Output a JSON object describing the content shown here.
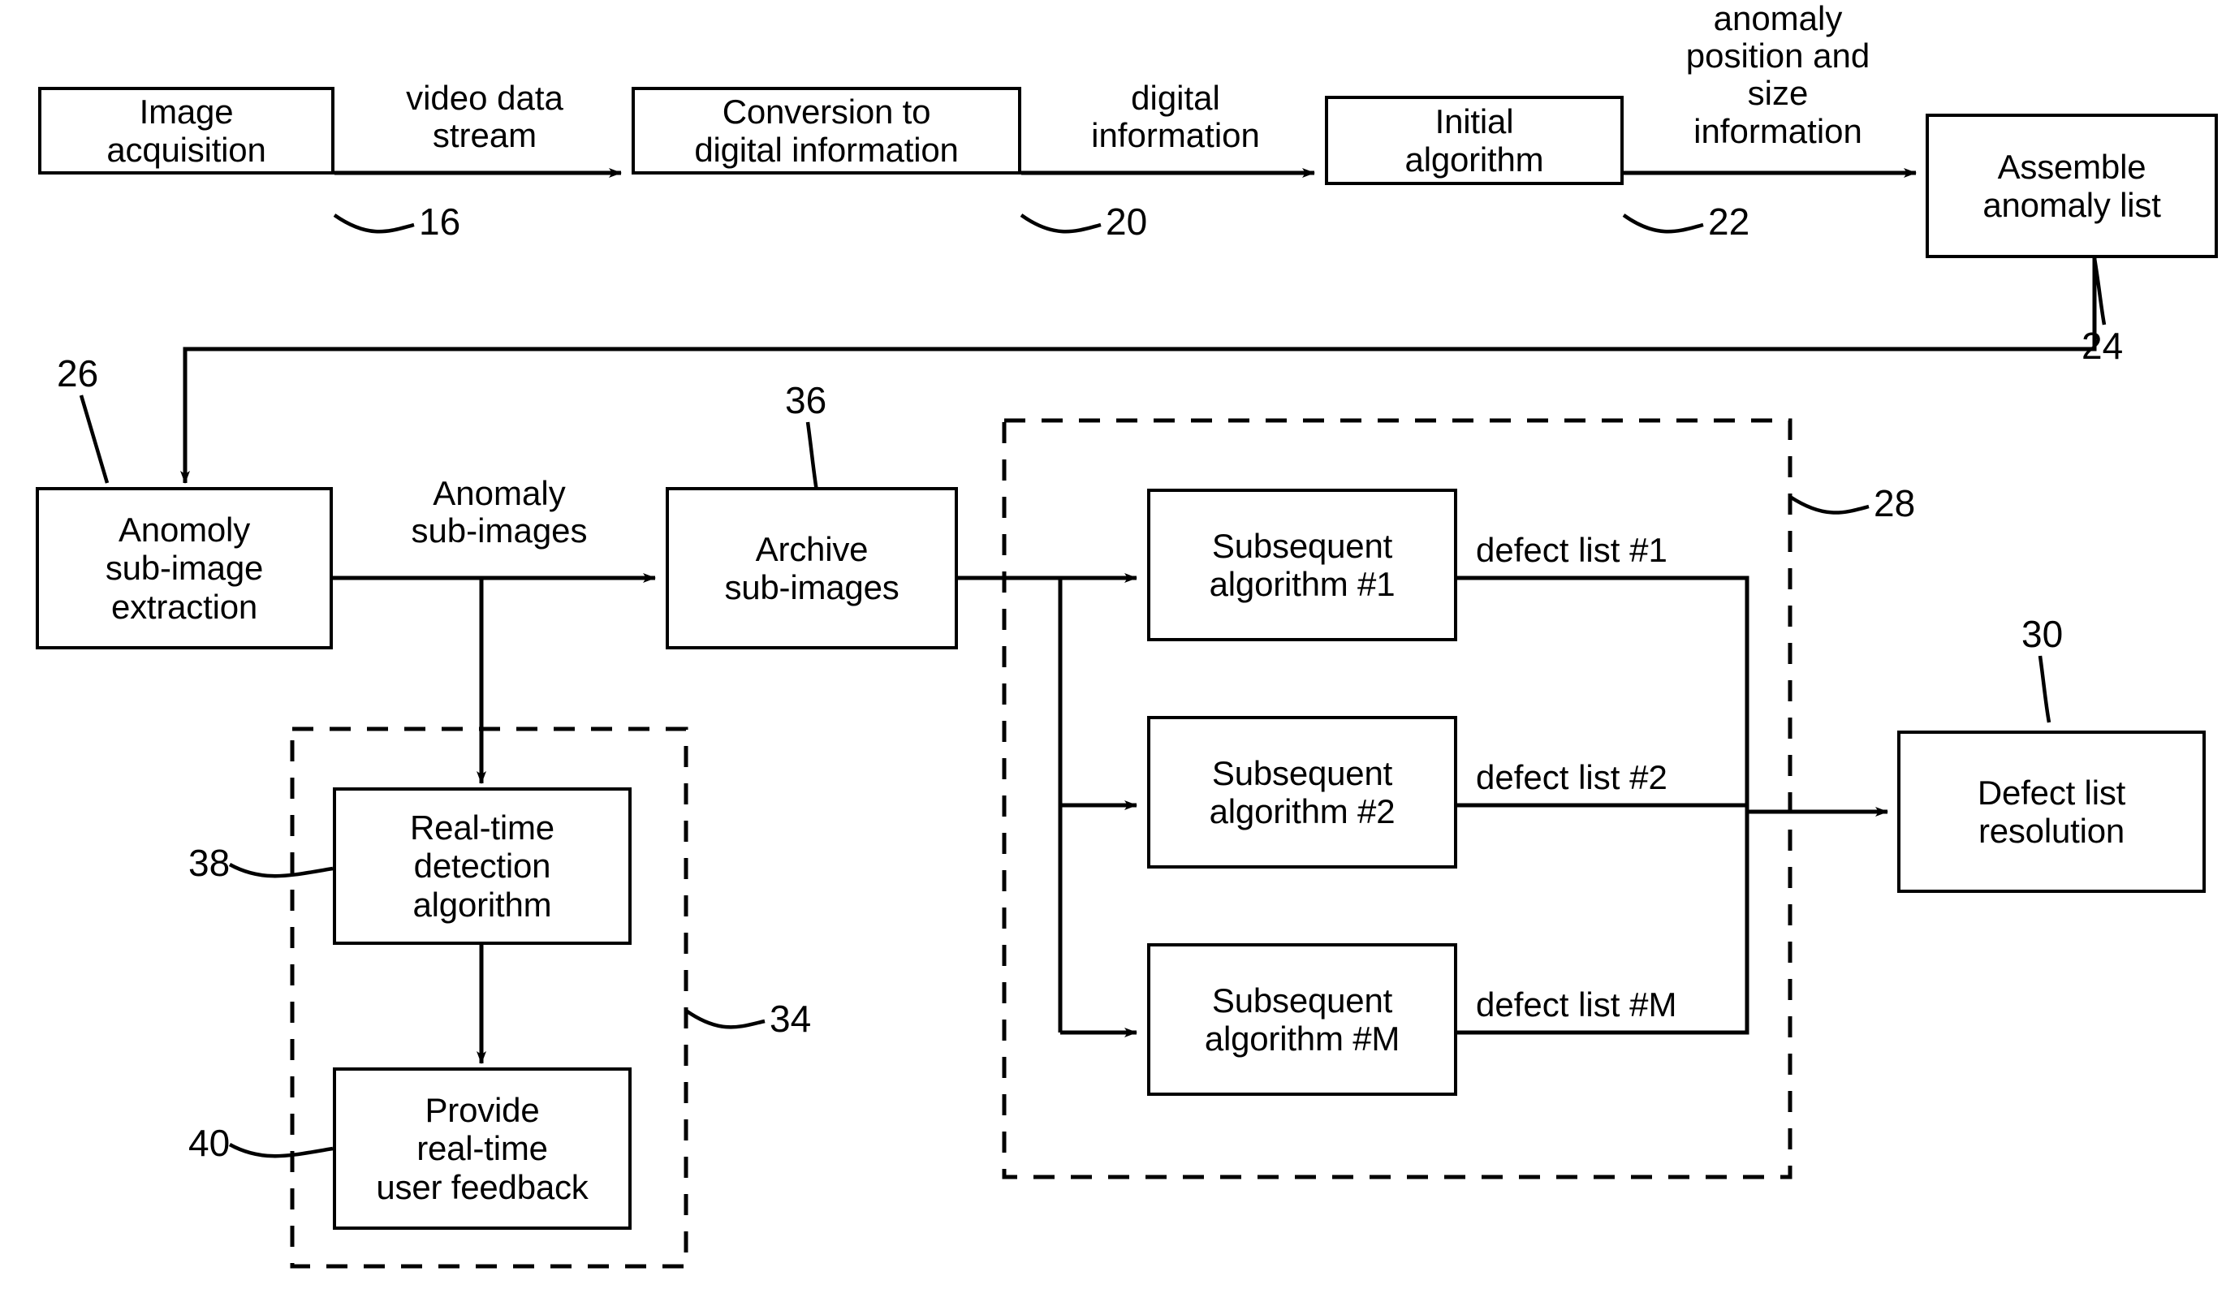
{
  "figure": {
    "kind": "patent-flow-diagram",
    "ink_color": "#000000",
    "background_color": "#ffffff"
  },
  "nodes": [
    {
      "id": "image-acquisition",
      "label": "Image\nacquisition"
    },
    {
      "id": "conversion-to-digital",
      "label": "Conversion to\ndigital information"
    },
    {
      "id": "initial-algorithm",
      "label": "Initial\nalgorithm"
    },
    {
      "id": "assemble-anomaly-list",
      "label": "Assemble\nanomaly list"
    },
    {
      "id": "anomaly-sub-image-extraction",
      "label": "Anomoly\nsub-image\nextraction"
    },
    {
      "id": "archive-sub-images",
      "label": "Archive\nsub-images"
    },
    {
      "id": "subsequent-algorithm-1",
      "label": "Subsequent\nalgorithm #1"
    },
    {
      "id": "subsequent-algorithm-2",
      "label": "Subsequent\nalgorithm #2"
    },
    {
      "id": "subsequent-algorithm-m",
      "label": "Subsequent\nalgorithm #M"
    },
    {
      "id": "real-time-detection",
      "label": "Real-time\ndetection\nalgorithm"
    },
    {
      "id": "provide-user-feedback",
      "label": "Provide\nreal-time\nuser feedback"
    },
    {
      "id": "defect-list-resolution",
      "label": "Defect list\nresolution"
    }
  ],
  "edge_labels": [
    {
      "id": "video-data-stream",
      "text": "video data\nstream"
    },
    {
      "id": "digital-information",
      "text": "digital\ninformation"
    },
    {
      "id": "anomaly-position-size",
      "text": "anomaly\nposition and\nsize\ninformation"
    },
    {
      "id": "anomaly-sub-images",
      "text": "Anomaly\nsub-images"
    },
    {
      "id": "defect-list-1",
      "text": "defect list #1"
    },
    {
      "id": "defect-list-2",
      "text": "defect list #2"
    },
    {
      "id": "defect-list-m",
      "text": "defect list #M"
    }
  ],
  "reference_numerals": [
    {
      "id": "ref-16",
      "text": "16"
    },
    {
      "id": "ref-20",
      "text": "20"
    },
    {
      "id": "ref-22",
      "text": "22"
    },
    {
      "id": "ref-24",
      "text": "24"
    },
    {
      "id": "ref-26",
      "text": "26"
    },
    {
      "id": "ref-28",
      "text": "28"
    },
    {
      "id": "ref-30",
      "text": "30"
    },
    {
      "id": "ref-34",
      "text": "34"
    },
    {
      "id": "ref-36",
      "text": "36"
    },
    {
      "id": "ref-38",
      "text": "38"
    },
    {
      "id": "ref-40",
      "text": "40"
    }
  ]
}
